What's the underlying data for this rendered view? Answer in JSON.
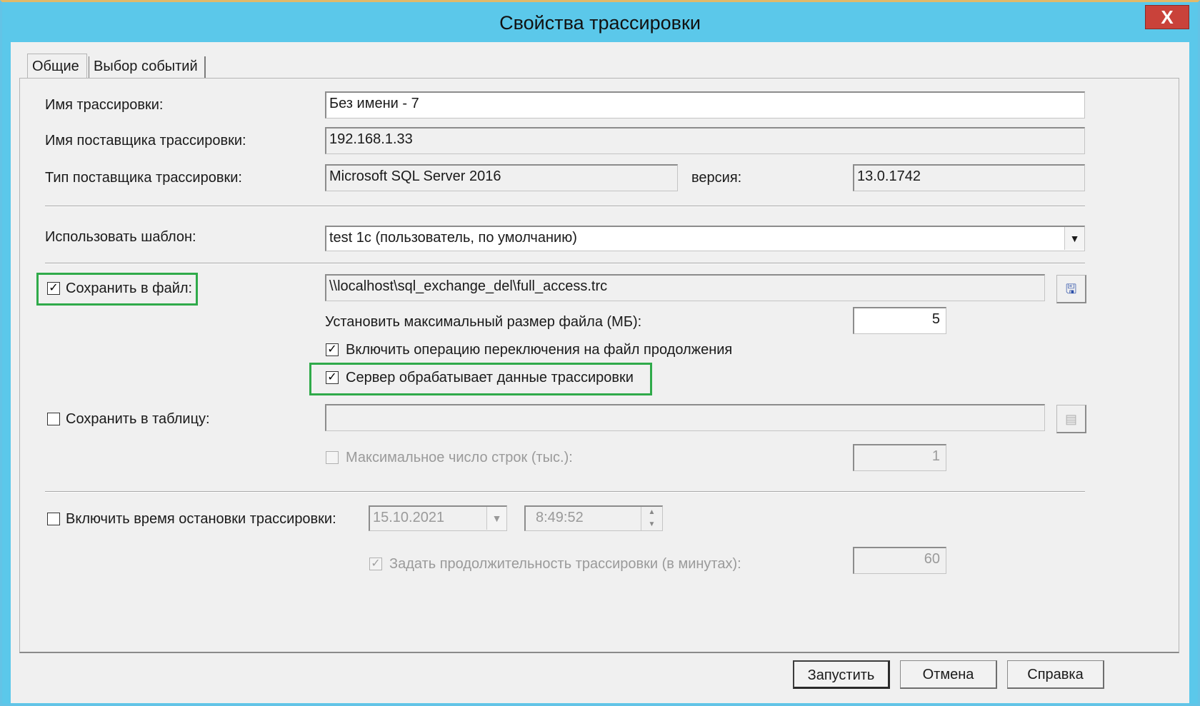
{
  "window": {
    "title": "Свойства трассировки",
    "close_glyph": "X"
  },
  "tabs": [
    {
      "label": "Общие"
    },
    {
      "label": "Выбор событий"
    }
  ],
  "trace_name": {
    "label": "Имя трассировки:",
    "value": "Без имени - 7"
  },
  "provider_name": {
    "label": "Имя поставщика трассировки:",
    "value": "192.168.1.33"
  },
  "provider_type": {
    "label": "Тип поставщика трассировки:",
    "value": "Microsoft SQL Server 2016",
    "version_label": "версия:",
    "version_value": "13.0.1742"
  },
  "template": {
    "label": "Использовать шаблон:",
    "value": "test 1c (пользователь, по умолчанию)"
  },
  "save_to_file": {
    "label": "Сохранить в файл:",
    "checked": true,
    "path": "\\\\localhost\\sql_exchange_del\\full_access.trc",
    "icon": "save-file-icon"
  },
  "max_file_size": {
    "label": "Установить максимальный размер файла (МБ):",
    "value": "5"
  },
  "enable_rollover": {
    "label": "Включить операцию переключения на файл продолжения",
    "checked": true
  },
  "server_processes": {
    "label": "Сервер обрабатывает данные трассировки",
    "checked": true
  },
  "save_to_table": {
    "label": "Сохранить в таблицу:",
    "checked": false,
    "value": "",
    "icon": "table-icon"
  },
  "max_rows": {
    "label": "Максимальное число строк (тыс.):",
    "checked": false,
    "value": "1"
  },
  "stop_time": {
    "label": "Включить время остановки трассировки:",
    "checked": false,
    "date": "15.10.2021",
    "time": "8:49:52"
  },
  "duration": {
    "label": "Задать продолжительность трассировки (в минутах):",
    "checked": true,
    "value": "60"
  },
  "buttons": {
    "run": "Запустить",
    "cancel": "Отмена",
    "help": "Справка"
  },
  "colors": {
    "title_bar": "#5bc8ea",
    "close_button": "#c9423a",
    "highlight": "#2faa4a",
    "dialog_bg": "#f0f0f0"
  }
}
